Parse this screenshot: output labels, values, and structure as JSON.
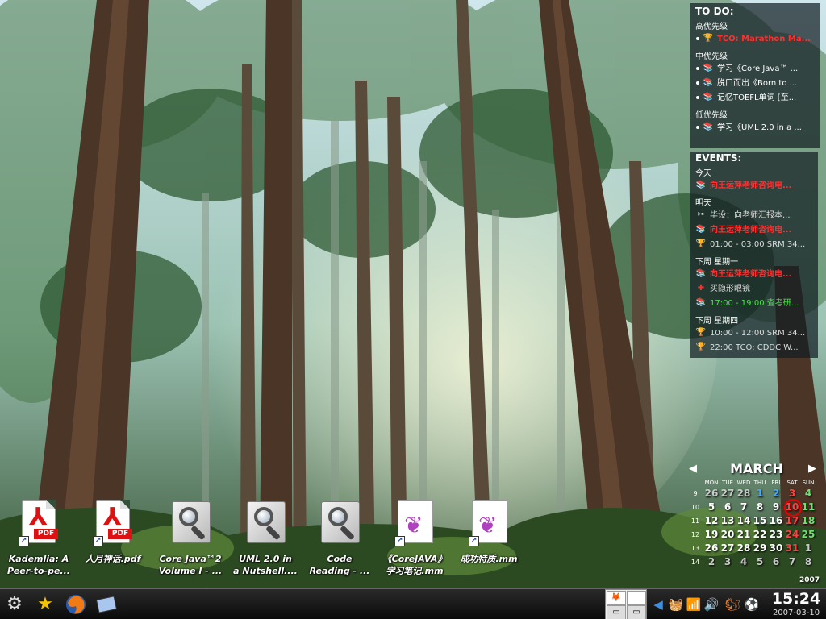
{
  "desktop": {
    "icons": [
      {
        "label": "Kademlia: A\nPeer-to-pe...",
        "type": "pdf-icon"
      },
      {
        "label": "人月神话.pdf",
        "type": "pdf-icon"
      },
      {
        "label": "Core Java™2\nVolume I - ...",
        "type": "search-document-icon"
      },
      {
        "label": "UML 2.0 in\na Nutshell....",
        "type": "search-document-icon"
      },
      {
        "label": "Code\nReading - ...",
        "type": "search-document-icon"
      },
      {
        "label": "《CoreJAVA》\n学习笔记.mm",
        "type": "mindmap-icon"
      },
      {
        "label": "成功特质.mm",
        "type": "mindmap-icon"
      }
    ],
    "pdf_label": "PDF"
  },
  "todo": {
    "title": "TO DO:",
    "high": {
      "heading": "高优先级",
      "items": [
        "TCO: Marathon Ma..."
      ]
    },
    "medium": {
      "heading": "中优先级",
      "items": [
        "学习《Core Java™ ...",
        "脱口而出《Born to ...",
        "记忆TOEFL单词 [至..."
      ]
    },
    "low": {
      "heading": "低优先级",
      "items": [
        "学习《UML 2.0 in a ..."
      ]
    }
  },
  "events": {
    "title": "EVENTS:",
    "today": {
      "heading": "今天",
      "items": [
        "向王运萍老师咨询电..."
      ]
    },
    "tomorrow": {
      "heading": "明天",
      "items": [
        "毕设：向老师汇报本...",
        "向王运萍老师咨询电...",
        "01:00 - 03:00 SRM 34..."
      ]
    },
    "next_monday": {
      "heading": "下周 星期一",
      "items": [
        "向王运萍老师咨询电...",
        "买隐形眼镜",
        "17:00 - 19:00 查考研..."
      ]
    },
    "next_thursday": {
      "heading": "下周 星期四",
      "items": [
        "10:00 - 12:00 SRM 34...",
        "22:00 TCO: CDDC W..."
      ]
    }
  },
  "calendar": {
    "month": "MARCH",
    "year": "2007",
    "prev_arrow": "◀",
    "next_arrow": "▶",
    "weekdays": [
      "MON",
      "TUE",
      "WED",
      "THU",
      "FRI",
      "SAT",
      "SUN"
    ],
    "weeks": [
      {
        "no": "9",
        "days": [
          "26",
          "27",
          "28",
          "1",
          "2",
          "3",
          "4"
        ]
      },
      {
        "no": "10",
        "days": [
          "5",
          "6",
          "7",
          "8",
          "9",
          "10",
          "11"
        ]
      },
      {
        "no": "11",
        "days": [
          "12",
          "13",
          "14",
          "15",
          "16",
          "17",
          "18"
        ]
      },
      {
        "no": "12",
        "days": [
          "19",
          "20",
          "21",
          "22",
          "23",
          "24",
          "25"
        ]
      },
      {
        "no": "13",
        "days": [
          "26",
          "27",
          "28",
          "29",
          "30",
          "31",
          "1"
        ]
      },
      {
        "no": "14",
        "days": [
          "2",
          "3",
          "4",
          "5",
          "6",
          "7",
          "8"
        ]
      }
    ],
    "today": "10"
  },
  "taskbar": {
    "launchers": [
      "kde-menu-icon",
      "star-bookmarks-icon",
      "firefox-icon",
      "desktop-switch-icon"
    ],
    "tray": [
      "volume-arrow-icon",
      "basket-icon",
      "network-icon",
      "sound-icon",
      "klipper-icon",
      "kdict-icon",
      "game-icon"
    ],
    "time": "15:24",
    "date": "2007-03-10"
  }
}
